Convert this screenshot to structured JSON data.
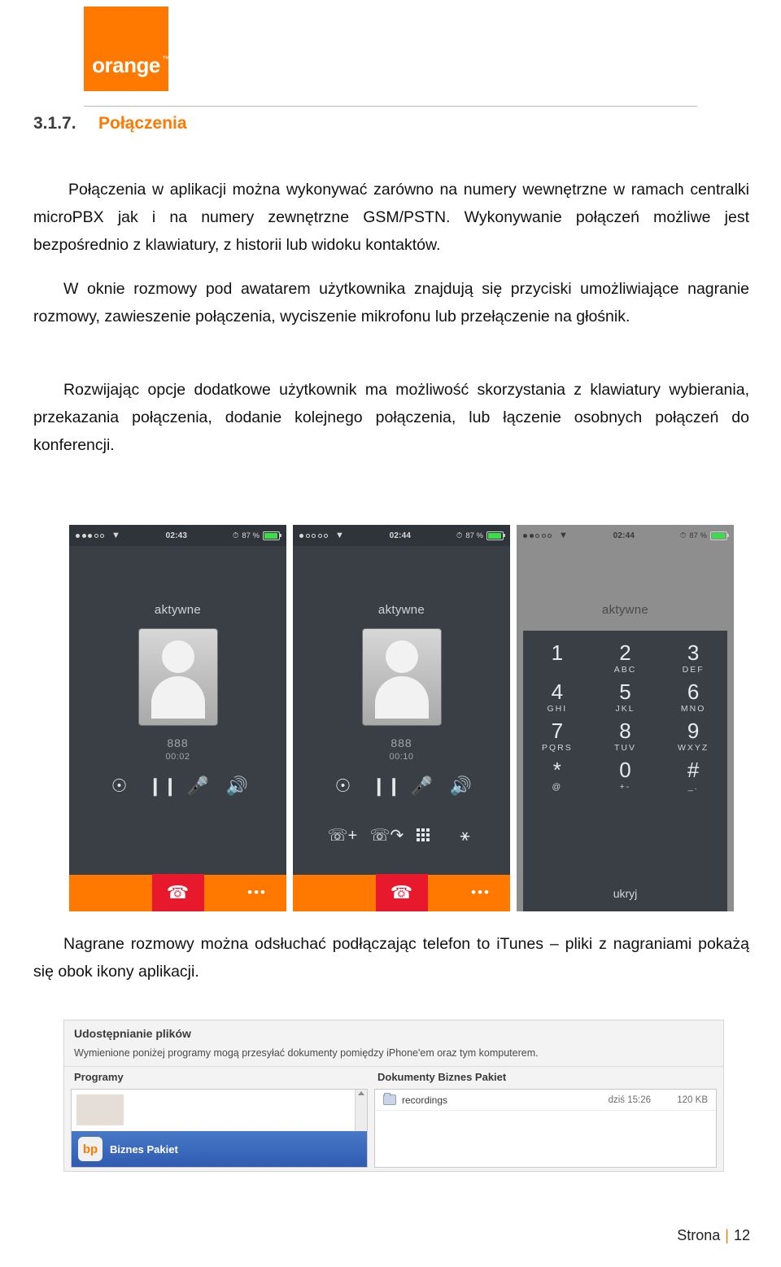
{
  "brand": {
    "logo_text": "orange",
    "logo_tm": "™",
    "logo_color": "#ff7900"
  },
  "section": {
    "number": "3.1.7.",
    "title": "Połączenia"
  },
  "paragraphs": {
    "p1": "Połączenia w aplikacji można wykonywać zarówno na numery wewnętrzne w ramach centralki microPBX jak i na numery zewnętrzne GSM/PSTN. Wykonywanie połączeń możliwe jest bezpośrednio z klawiatury, z historii lub widoku kontaktów.",
    "p2": "W oknie rozmowy pod awatarem użytkownika znajdują się przyciski umożliwiające nagranie rozmowy, zawieszenie połączenia, wyciszenie mikrofonu lub przełączenie na głośnik.",
    "p3": "Rozwijając opcje dodatkowe użytkownik ma możliwość skorzystania z klawiatury wybierania, przekazania połączenia, dodanie kolejnego połączenia, lub łączenie osobnych połączeń do konferencji.",
    "p4": "Nagrane rozmowy można odsłuchać podłączając telefon to iTunes – pliki z nagraniami pokażą się obok ikony aplikacji."
  },
  "screenshots": [
    {
      "status": {
        "time": "02:43",
        "battery_pct": "87 %",
        "signal_filled": 3,
        "signal_empty": 2
      },
      "header": "aktywne",
      "call_number": "888",
      "call_timer": "00:02",
      "controls": [
        "record-icon",
        "pause-icon",
        "microphone-icon",
        "speaker-icon"
      ],
      "extra_controls": [],
      "more_dots": "•••"
    },
    {
      "status": {
        "time": "02:44",
        "battery_pct": "87 %",
        "signal_filled": 1,
        "signal_empty": 4
      },
      "header": "aktywne",
      "call_number": "888",
      "call_timer": "00:10",
      "controls": [
        "record-icon",
        "pause-icon",
        "microphone-icon",
        "speaker-icon"
      ],
      "extra_controls": [
        "add-call-icon",
        "transfer-call-icon",
        "keypad-icon",
        "conference-icon"
      ],
      "more_dots": "•••"
    },
    {
      "status": {
        "time": "02:44",
        "battery_pct": "87 %",
        "signal_filled": 2,
        "signal_empty": 3
      },
      "header": "aktywne",
      "keypad": [
        {
          "digit": "1",
          "letters": ""
        },
        {
          "digit": "2",
          "letters": "ABC"
        },
        {
          "digit": "3",
          "letters": "DEF"
        },
        {
          "digit": "4",
          "letters": "GHI"
        },
        {
          "digit": "5",
          "letters": "JKL"
        },
        {
          "digit": "6",
          "letters": "MNO"
        },
        {
          "digit": "7",
          "letters": "PQRS"
        },
        {
          "digit": "8",
          "letters": "TUV"
        },
        {
          "digit": "9",
          "letters": "WXYZ"
        },
        {
          "digit": "*",
          "letters": "@"
        },
        {
          "digit": "0",
          "letters": "+-"
        },
        {
          "digit": "#",
          "letters": "_."
        }
      ],
      "hide_label": "ukryj"
    }
  ],
  "itunes": {
    "title": "Udostępnianie plików",
    "subtitle": "Wymienione poniżej programy mogą przesyłać dokumenty pomiędzy iPhone'em oraz tym komputerem.",
    "col_left": "Programy",
    "col_right": "Dokumenty Biznes Pakiet",
    "app": {
      "icon_text": "bp",
      "name": "Biznes Pakiet"
    },
    "file": {
      "name": "recordings",
      "date": "dziś 15:26",
      "size": "120 KB"
    }
  },
  "footer": {
    "label": "Strona",
    "separator": "|",
    "page": "12"
  }
}
